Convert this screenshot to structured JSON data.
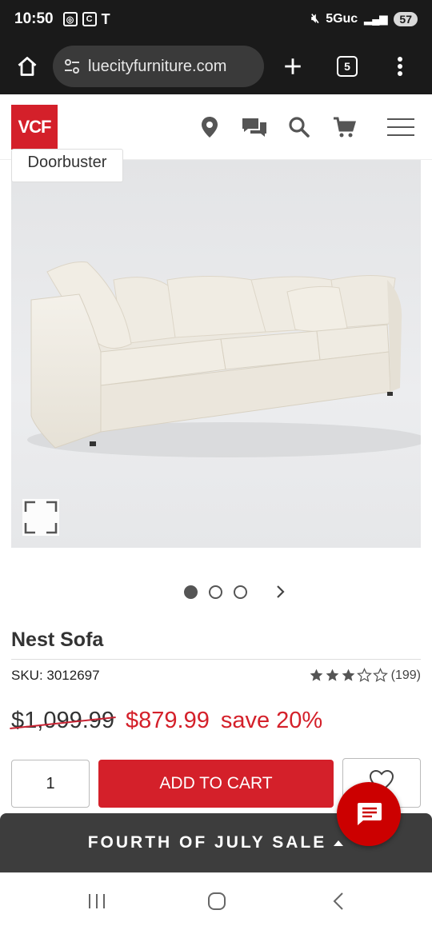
{
  "status_bar": {
    "time": "10:50",
    "network": "5Guc",
    "battery": "57"
  },
  "browser": {
    "url": "luecityfurniture.com",
    "tab_count": "5"
  },
  "site": {
    "logo_text": "VCF",
    "brand_color": "#d4202a"
  },
  "product": {
    "badge": "Doorbuster",
    "title": "Nest Sofa",
    "sku": "SKU: 3012697",
    "rating_value": 3,
    "rating_max": 5,
    "review_count": "(199)",
    "old_price": "$1,099.99",
    "new_price": "$879.99",
    "save_text": "save 20%",
    "quantity": "1",
    "add_to_cart_label": "ADD TO CART"
  },
  "carousel": {
    "slide_count": 3,
    "active_index": 0
  },
  "sale_banner": {
    "label": "FOURTH OF JULY SALE"
  },
  "icons": [
    "home-icon",
    "tune-icon",
    "plus-icon",
    "more-icon",
    "location-icon",
    "chat-bubbles-icon",
    "search-icon",
    "cart-icon",
    "menu-icon",
    "expand-icon",
    "chevron-right-icon",
    "star-icon",
    "heart-icon",
    "chat-icon",
    "caret-up-icon",
    "recent-apps-icon",
    "home-nav-icon",
    "back-icon"
  ]
}
